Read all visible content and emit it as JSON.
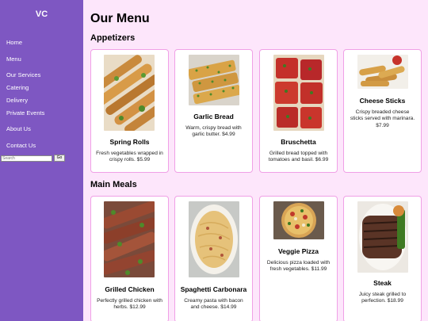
{
  "sidebar": {
    "logo": "VC",
    "nav": [
      "Home",
      "Menu",
      "Our Services",
      "Catering",
      "Delivery",
      "Private Events",
      "About Us",
      "Contact Us"
    ],
    "search_placeholder": "Search",
    "search_button": "Go"
  },
  "page_title": "Our Menu",
  "sections": [
    {
      "title": "Appetizers",
      "items": [
        {
          "name": "Spring Rolls",
          "description": "Fresh vegetables wrapped in crispy rolls. $5.99"
        },
        {
          "name": "Garlic Bread",
          "description": "Warm, crispy bread with garlic butter. $4.99"
        },
        {
          "name": "Bruschetta",
          "description": "Grilled bread topped with tomatoes and basil. $6.99"
        },
        {
          "name": "Cheese Sticks",
          "description": "Crispy breaded cheese sticks served with marinara. $7.99"
        }
      ]
    },
    {
      "title": "Main Meals",
      "items": [
        {
          "name": "Grilled Chicken",
          "description": "Perfectly grilled chicken with herbs. $12.99"
        },
        {
          "name": "Spaghetti Carbonara",
          "description": "Creamy pasta with bacon and cheese. $14.99"
        },
        {
          "name": "Veggie Pizza",
          "description": "Delicious pizza loaded with fresh vegetables. $11.99"
        },
        {
          "name": "Steak",
          "description": "Juicy steak grilled to perfection. $18.99"
        }
      ]
    }
  ]
}
